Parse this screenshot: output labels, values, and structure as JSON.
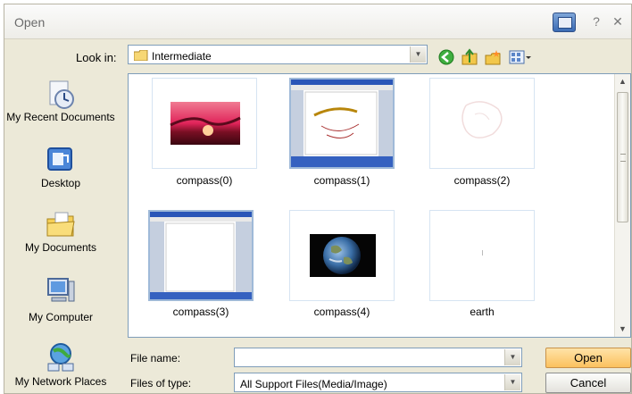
{
  "window": {
    "title": "Open"
  },
  "lookin": {
    "label": "Look in:",
    "value": "Intermediate"
  },
  "toolbar_icons": [
    "back-icon",
    "up-folder-icon",
    "new-folder-icon",
    "view-menu-icon"
  ],
  "places": [
    {
      "label": "My Recent Documents",
      "icon": "recent-documents-icon"
    },
    {
      "label": "Desktop",
      "icon": "desktop-icon"
    },
    {
      "label": "My Documents",
      "icon": "my-documents-icon"
    },
    {
      "label": "My Computer",
      "icon": "my-computer-icon"
    },
    {
      "label": "My Network Places",
      "icon": "network-places-icon"
    }
  ],
  "files": [
    {
      "name": "compass(0)"
    },
    {
      "name": "compass(1)"
    },
    {
      "name": "compass(2)"
    },
    {
      "name": "compass(3)"
    },
    {
      "name": "compass(4)"
    },
    {
      "name": "earth"
    }
  ],
  "form": {
    "filename_label": "File name:",
    "filename_value": "",
    "filetype_label": "Files of type:",
    "filetype_value": "All Support Files(Media/Image)"
  },
  "buttons": {
    "open": "Open",
    "cancel": "Cancel"
  }
}
